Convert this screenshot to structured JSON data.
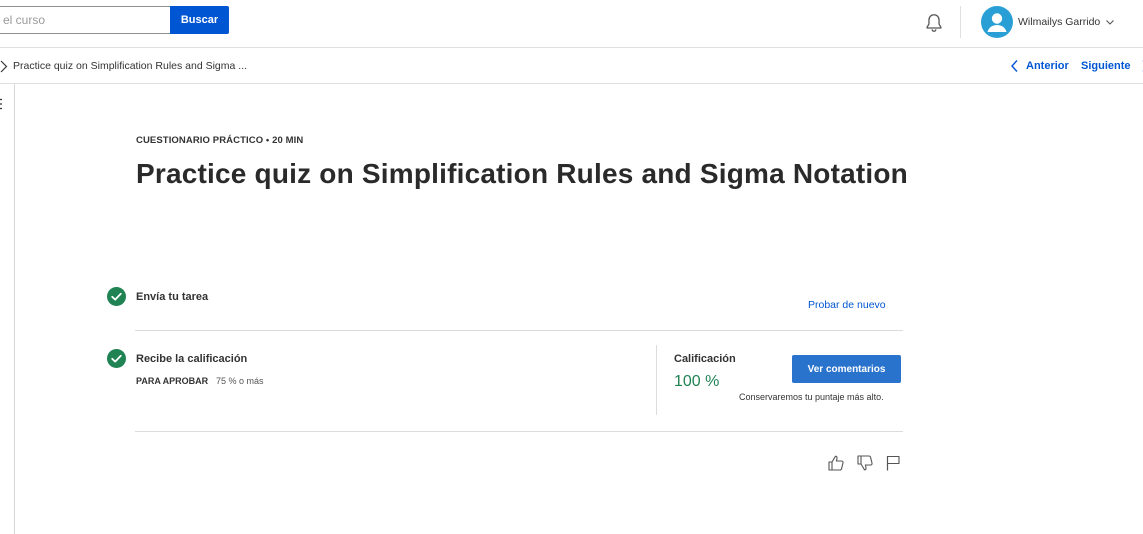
{
  "header": {
    "search": {
      "placeholder": "el curso",
      "value": ""
    },
    "search_button_label": "Buscar",
    "user_name": "Wilmailys Garrido",
    "icons": [
      "bell-icon",
      "avatar-icon",
      "chevron-down-icon"
    ]
  },
  "breadcrumb": {
    "current": "Practice quiz on Simplification Rules and Sigma ..."
  },
  "pagination": {
    "prev_label": "Anterior",
    "next_label": "Siguiente"
  },
  "quiz": {
    "overline": "CUESTIONARIO PRÁCTICO • 20 MIN",
    "title": "Practice quiz on Simplification Rules and Sigma Notation",
    "step1_label": "Envía tu tarea",
    "retry_label": "Probar de nuevo",
    "step2_label": "Recibe la calificación",
    "pass_label": "PARA APROBAR",
    "pass_value": "75 % o más",
    "grade_label": "Calificación",
    "grade_value": "100 %",
    "feedback_button_label": "Ver comentarios",
    "keep_note": "Conservaremos tu puntaje más alto."
  },
  "colors": {
    "accent": "#0056d2",
    "success": "#1f8354",
    "avatar": "#2a9fd6"
  }
}
